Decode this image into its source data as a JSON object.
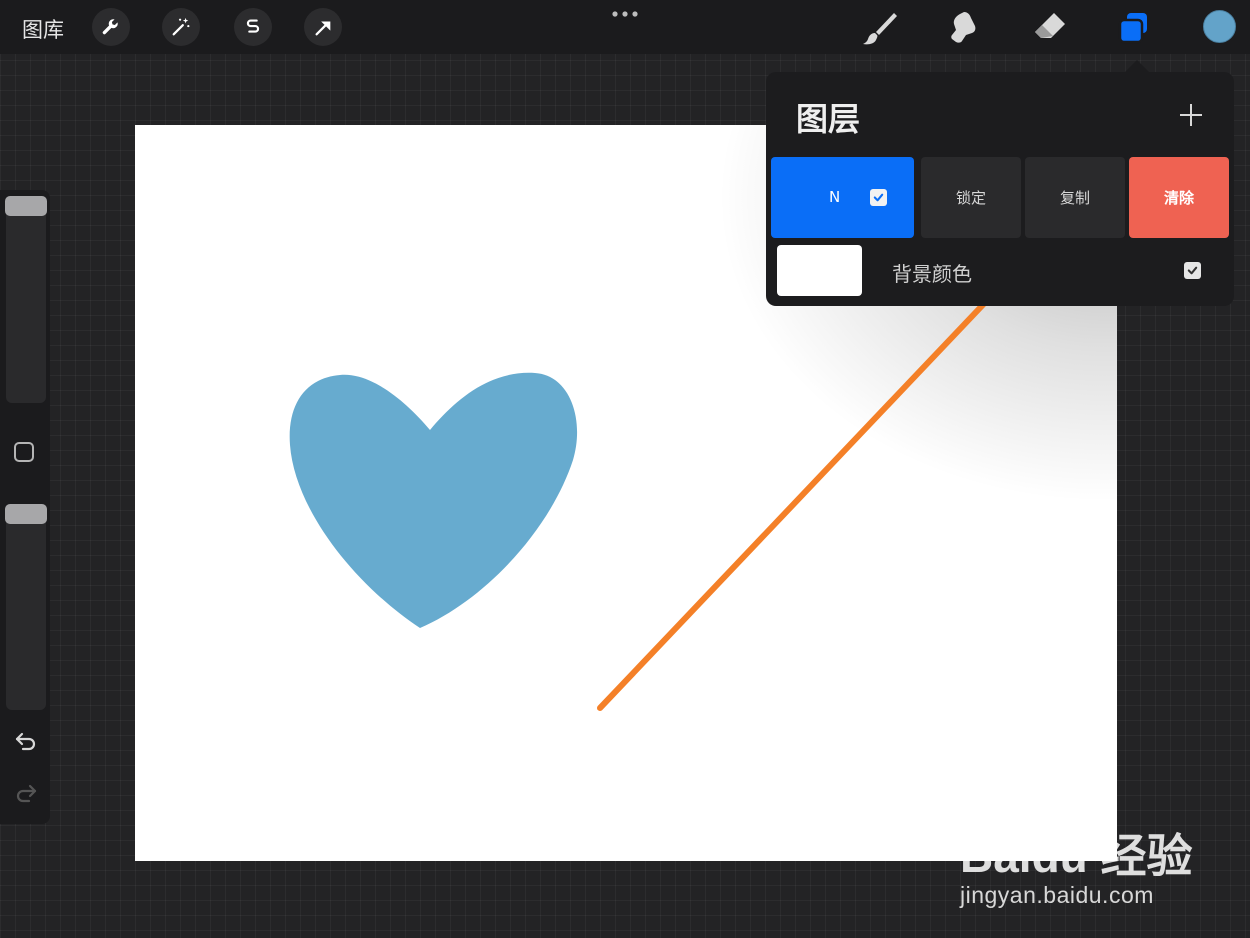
{
  "topbar": {
    "gallery_label": "图库",
    "left_tools": [
      "wrench-icon",
      "magic-wand-icon",
      "selection-icon",
      "transform-arrow-icon"
    ],
    "right_tools": [
      "brush-icon",
      "smudge-icon",
      "eraser-icon",
      "layers-icon"
    ],
    "current_color": "#63a3c9"
  },
  "layers_panel": {
    "title": "图层",
    "layer": {
      "blend_mode": "N",
      "visible": true,
      "actions": {
        "lock": "锁定",
        "duplicate": "复制",
        "clear": "清除"
      }
    },
    "background": {
      "label": "背景颜色",
      "color": "#ffffff",
      "visible": true
    }
  },
  "canvas": {
    "heart_color": "#67abcf",
    "arrow_color": "#f48028"
  },
  "colors": {
    "accent": "#0a6ef7",
    "danger": "#ef6252"
  },
  "watermark": {
    "logo_text": "Baidu 经验",
    "url": "jingyan.baidu.com"
  }
}
